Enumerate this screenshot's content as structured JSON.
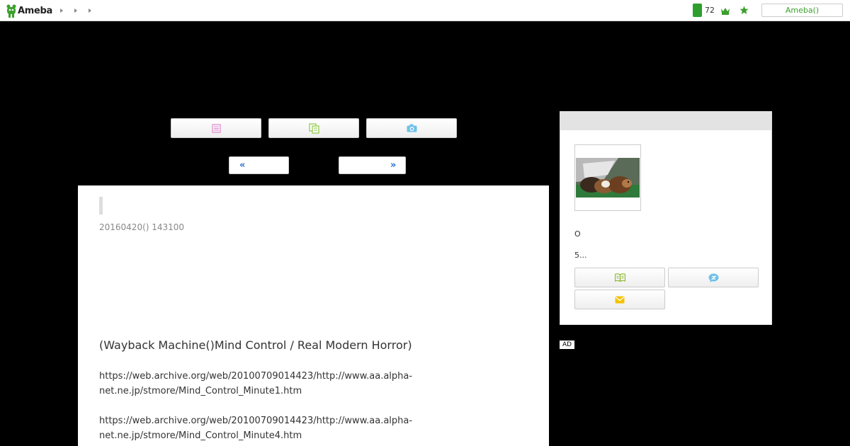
{
  "header": {
    "logo_text": "Ameba",
    "count": "72",
    "ameba_button_label": "Ameba()"
  },
  "pager": {
    "prev_label": "«",
    "next_label": "»"
  },
  "article": {
    "date": "20160420() 143100",
    "heading": "(Wayback Machine()Mind Control / Real Modern Horror)",
    "links": [
      "https://web.archive.org/web/20100709014423/http://www.aa.alpha-net.ne.jp/stmore/Mind_Control_Minute1.htm",
      "https://web.archive.org/web/20100709014423/http://www.aa.alpha-net.ne.jp/stmore/Mind_Control_Minute4.htm"
    ]
  },
  "sidebar": {
    "profile_line_1": "O",
    "profile_line_2": "5..."
  },
  "ad": {
    "label": "AD"
  },
  "colors": {
    "brand_green": "#3b9f2c",
    "link_blue": "#2c6fc7",
    "background": "#000000"
  }
}
